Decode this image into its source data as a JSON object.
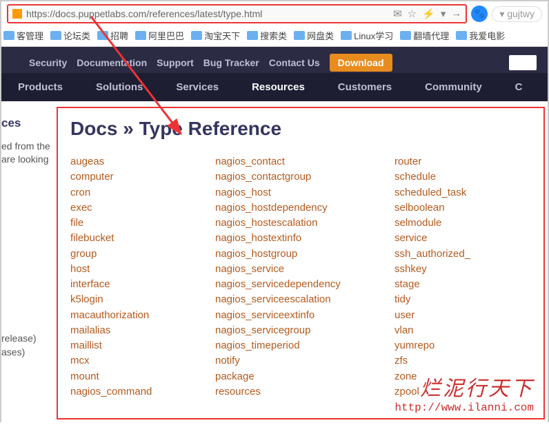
{
  "browser": {
    "url": "https://docs.puppetlabs.com/references/latest/type.html",
    "username": "gujtwy"
  },
  "bookmarks": [
    "客管理",
    "论坛类",
    "招聘",
    "阿里巴巴",
    "淘宝天下",
    "搜索类",
    "网盘类",
    "Linux学习",
    "翻墙代理",
    "我爱电影"
  ],
  "topnav": {
    "links": [
      "Security",
      "Documentation",
      "Support",
      "Bug Tracker",
      "Contact Us"
    ],
    "download": "Download"
  },
  "mainnav": {
    "items": [
      "Products",
      "Solutions",
      "Services",
      "Resources",
      "Customers",
      "Community",
      "C"
    ],
    "active_index": 3
  },
  "sidebar": {
    "heading": "ces",
    "line1": "ed from the",
    "line2": "are looking",
    "line3": "release)",
    "line4": "ases)"
  },
  "page": {
    "title": "Docs » Type Reference",
    "types_col1": [
      "augeas",
      "computer",
      "cron",
      "exec",
      "file",
      "filebucket",
      "group",
      "host",
      "interface",
      "k5login",
      "macauthorization",
      "mailalias",
      "maillist",
      "mcx",
      "mount",
      "nagios_command"
    ],
    "types_col2": [
      "nagios_contact",
      "nagios_contactgroup",
      "nagios_host",
      "nagios_hostdependency",
      "nagios_hostescalation",
      "nagios_hostextinfo",
      "nagios_hostgroup",
      "nagios_service",
      "nagios_servicedependency",
      "nagios_serviceescalation",
      "nagios_serviceextinfo",
      "nagios_servicegroup",
      "nagios_timeperiod",
      "notify",
      "package",
      "resources"
    ],
    "types_col3": [
      "router",
      "schedule",
      "scheduled_task",
      "selboolean",
      "selmodule",
      "service",
      "ssh_authorized_",
      "sshkey",
      "stage",
      "tidy",
      "user",
      "vlan",
      "yumrepo",
      "zfs",
      "zone",
      "zpool"
    ]
  },
  "watermark": {
    "cn": "烂泥行天下",
    "url": "http://www.ilanni.com"
  }
}
